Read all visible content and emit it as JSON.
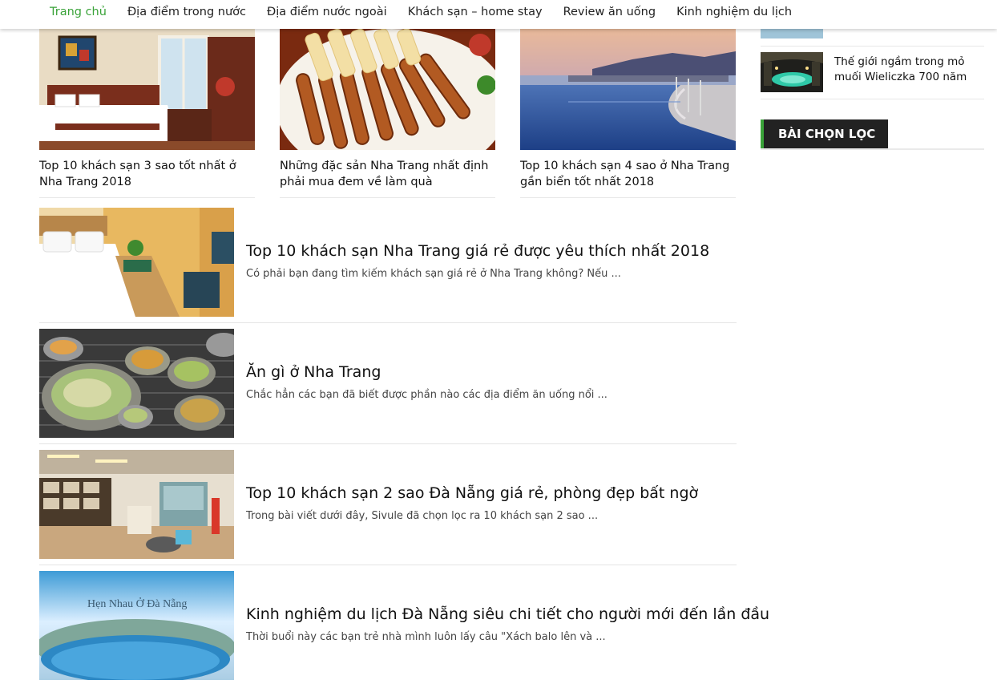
{
  "nav": {
    "items": [
      {
        "label": "Trang chủ",
        "active": true
      },
      {
        "label": "Địa điểm trong nước",
        "active": false
      },
      {
        "label": "Địa điểm nước ngoài",
        "active": false
      },
      {
        "label": "Khách sạn – home stay",
        "active": false
      },
      {
        "label": "Review ăn uống",
        "active": false
      },
      {
        "label": "Kinh nghiệm du lịch",
        "active": false
      }
    ],
    "accent_color": "#3aa339"
  },
  "grid_posts": [
    {
      "title": "Top 10 khách sạn 3 sao tốt nhất ở Nha Trang 2018",
      "image": "hotel-room-image"
    },
    {
      "title": "Những đặc sản Nha Trang nhất định phải mua đem về làm quà",
      "image": "grilled-sausage-image"
    },
    {
      "title": "Top 10 khách sạn 4 sao ở Nha Trang gần biển tốt nhất 2018",
      "image": "infinity-pool-image"
    }
  ],
  "list_posts": [
    {
      "title": "Top 10 khách sạn Nha Trang giá rẻ được yêu thích nhất 2018",
      "excerpt": "Có phải bạn đang tìm kiếm khách sạn giá rẻ ở Nha Trang không? Nếu ...",
      "image": "hotel-room-image"
    },
    {
      "title": "Ăn gì ở Nha Trang",
      "excerpt": "Chắc hẳn các bạn đã biết được phần nào các địa điểm ăn uống nổi ...",
      "image": "grilled-oysters-image"
    },
    {
      "title": "Top 10 khách sạn 2 sao Đà Nẵng giá rẻ, phòng đẹp bất ngờ",
      "excerpt": "Trong bài viết dưới đây, Sivule đã chọn lọc ra 10 khách sạn 2 sao ...",
      "image": "hotel-lobby-image"
    },
    {
      "title": "Kinh nghiệm du lịch Đà Nẵng siêu chi tiết cho người mới đến lần đầu",
      "excerpt": "Thời buổi này các bạn trẻ nhà mình luôn lấy câu \"Xách balo lên và ...",
      "image": "da-nang-bay-image",
      "image_caption": "Hẹn Nhau Ở Đà Nẵng"
    }
  ],
  "sidebar": {
    "posts": [
      {
        "title": "Thế giới ngầm trong mỏ muối Wieliczka 700 năm",
        "image": "salt-mine-image"
      }
    ],
    "widget_title": "BÀI CHỌN LỌC"
  }
}
